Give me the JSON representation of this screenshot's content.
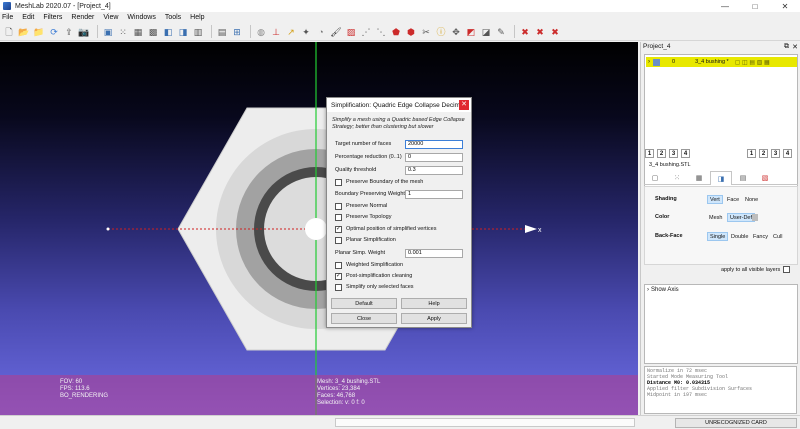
{
  "window": {
    "title": "MeshLab 2020.07 - [Project_4]",
    "controls": {
      "minimize": "—",
      "maximize": "□",
      "close": "✕"
    }
  },
  "menu": [
    "File",
    "Edit",
    "Filters",
    "Render",
    "View",
    "Windows",
    "Tools",
    "Help"
  ],
  "viewport": {
    "info_left": [
      "FOV: 60",
      "FPS:  113.6",
      "BO_RENDERING"
    ],
    "info_mid": [
      "Mesh: 3_4 bushing.STL",
      "Vertices: 23,384",
      "Faces: 46,768",
      "Selection: v: 0 f: 0"
    ],
    "axis_label": "x"
  },
  "dialog": {
    "title": "Simplification: Quadric Edge Collapse Decim...",
    "description": "Simplify a mesh using a Quadric based Edge Collapse Strategy; better than clustering but slower",
    "target_faces_label": "Target number of faces",
    "target_faces_value": "20000",
    "percentage_label": "Percentage reduction (0..1)",
    "percentage_value": "0",
    "quality_label": "Quality threshold",
    "quality_value": "0.3",
    "preserve_boundary_label": "Preserve Boundary of the mesh",
    "boundary_weight_label": "Boundary Preserving Weight",
    "boundary_weight_value": "1",
    "preserve_normal_label": "Preserve Normal",
    "preserve_topology_label": "Preserve Topology",
    "optimal_position_label": "Optimal position of simplified vertices",
    "planar_simplification_label": "Planar Simplification",
    "planar_weight_label": "Planar Simp. Weight",
    "planar_weight_value": "0.001",
    "weighted_label": "Weighted Simplification",
    "post_cleaning_label": "Post-simplification cleaning",
    "selected_only_label": "Simplify only selected faces",
    "checks": {
      "preserve_boundary": false,
      "preserve_normal": false,
      "preserve_topology": false,
      "optimal_position": true,
      "planar_simplification": false,
      "weighted": false,
      "post_cleaning": true,
      "selected_only": false
    },
    "buttons": {
      "default": "Default",
      "help": "Help",
      "close": "Close",
      "apply": "Apply"
    }
  },
  "panel": {
    "title": "Project_4",
    "layer": {
      "index": "0",
      "name": "3_4 bushing *"
    },
    "layer_buttons": [
      "1",
      "2",
      "3",
      "4"
    ],
    "mesh_name": "3_4 bushing.STL",
    "shading": {
      "label": "Shading",
      "options": [
        "Vert",
        "Face",
        "None"
      ],
      "selected": "Vert"
    },
    "color": {
      "label": "Color",
      "options": [
        "Mesh",
        "User-Def"
      ],
      "selected": "User-Def"
    },
    "backface": {
      "label": "Back-Face",
      "options": [
        "Single",
        "Double",
        "Fancy",
        "Cull"
      ],
      "selected": "Single"
    },
    "apply_all_label": "apply to all visible layers",
    "show_axis_label": "Show Axis",
    "log": [
      "Normalize in 72 msec",
      "Started Mode Measuring Tool",
      "Distance M0: 0.034315",
      "Applied filter Subdivision Surfaces",
      "Midpoint in 197 msec"
    ]
  },
  "status": {
    "card": "UNRECOGNIZED CARD"
  },
  "colors": {
    "selected_layer": "#e8e800",
    "axis_green": "#22cc33",
    "axis_red": "#d02020",
    "info_bar": "#b43c8c"
  }
}
